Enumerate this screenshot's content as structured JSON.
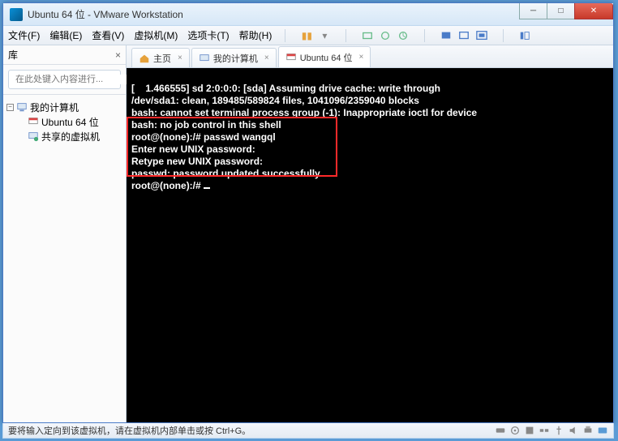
{
  "titlebar": {
    "title": "Ubuntu 64 位 - VMware Workstation"
  },
  "menu": {
    "file": "文件(F)",
    "edit": "编辑(E)",
    "view": "查看(V)",
    "vm": "虚拟机(M)",
    "tabs": "选项卡(T)",
    "help": "帮助(H)"
  },
  "sidebar": {
    "header": "库",
    "search_placeholder": "在此处键入内容进行...",
    "root": "我的计算机",
    "node_ubuntu": "Ubuntu 64 位",
    "node_shared": "共享的虚拟机"
  },
  "tabs_row": {
    "home": "主页",
    "mypc": "我的计算机",
    "ubuntu": "Ubuntu 64 位"
  },
  "terminal": {
    "l1": "[    1.466555] sd 2:0:0:0: [sda] Assuming drive cache: write through",
    "l2": "/dev/sda1: clean, 189485/589824 files, 1041096/2359040 blocks",
    "l3": "bash: cannot set terminal process group (-1): Inappropriate ioctl for device",
    "l4": "bash: no job control in this shell",
    "l5": "root@(none):/# passwd wangql",
    "l6": "Enter new UNIX password:",
    "l7": "Retype new UNIX password:",
    "l8": "passwd: password updated successfully",
    "l9": "root@(none):/# "
  },
  "statusbar": {
    "text": "要将输入定向到该虚拟机，请在虚拟机内部单击或按 Ctrl+G。"
  }
}
